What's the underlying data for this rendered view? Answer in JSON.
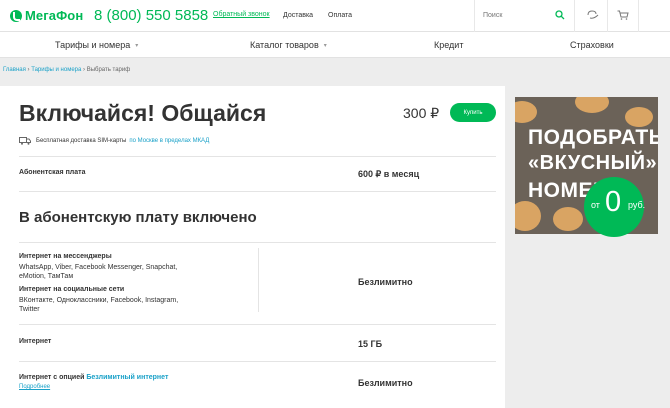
{
  "header": {
    "logo_text": "МегаФон",
    "phone": "8 (800) 550 5858",
    "callback_label": "Обратный звонок",
    "nav": [
      "Доставка",
      "Оплата"
    ],
    "search_placeholder": "Поиск",
    "brand_color": "#00b956"
  },
  "menu": {
    "items": [
      {
        "label": "Тарифы и номера",
        "has_dropdown": true
      },
      {
        "label": "Каталог товаров",
        "has_dropdown": true
      },
      {
        "label": "Кредит",
        "has_dropdown": false
      },
      {
        "label": "Страховки",
        "has_dropdown": false
      }
    ]
  },
  "breadcrumbs": [
    "Главная",
    "Тарифы и номера",
    "Выбрать тариф"
  ],
  "tariff": {
    "title": "Включайся! Общайся",
    "price": "300 ₽",
    "buy_label": "Купить",
    "delivery_text": "Бесплатная доставка SIM-карты",
    "delivery_link": "по Москве в пределах МКАД"
  },
  "fee": {
    "label": "Абонентская плата",
    "value": "600 ₽ в месяц"
  },
  "included": {
    "title": "В абонентскую плату включено",
    "messengers_label": "Интернет на мессенджеры",
    "messengers_list": [
      "WhatsApp, Viber, Facebook Messenger, Snapchat,",
      "eMotion, ТамТам"
    ],
    "social_label": "Интернет на социальные сети",
    "social_list": [
      "ВКонтакте, Одноклассники, Facebook, Instagram,",
      "Twitter"
    ],
    "unlimited_value": "Безлимитно",
    "internet_label": "Интернет",
    "internet_value": "15 ГБ",
    "option_label_prefix": "Интернет с опцией",
    "option_link": "Безлимитный интернет",
    "option_more": "Подробнее",
    "option_value": "Безлимитно"
  },
  "promo": {
    "lines": [
      "ПОДОБРАТЬ",
      "«ВКУСНЫЙ»",
      "НОМЕР"
    ],
    "prefix": "от",
    "number": "0",
    "suffix": "руб."
  }
}
